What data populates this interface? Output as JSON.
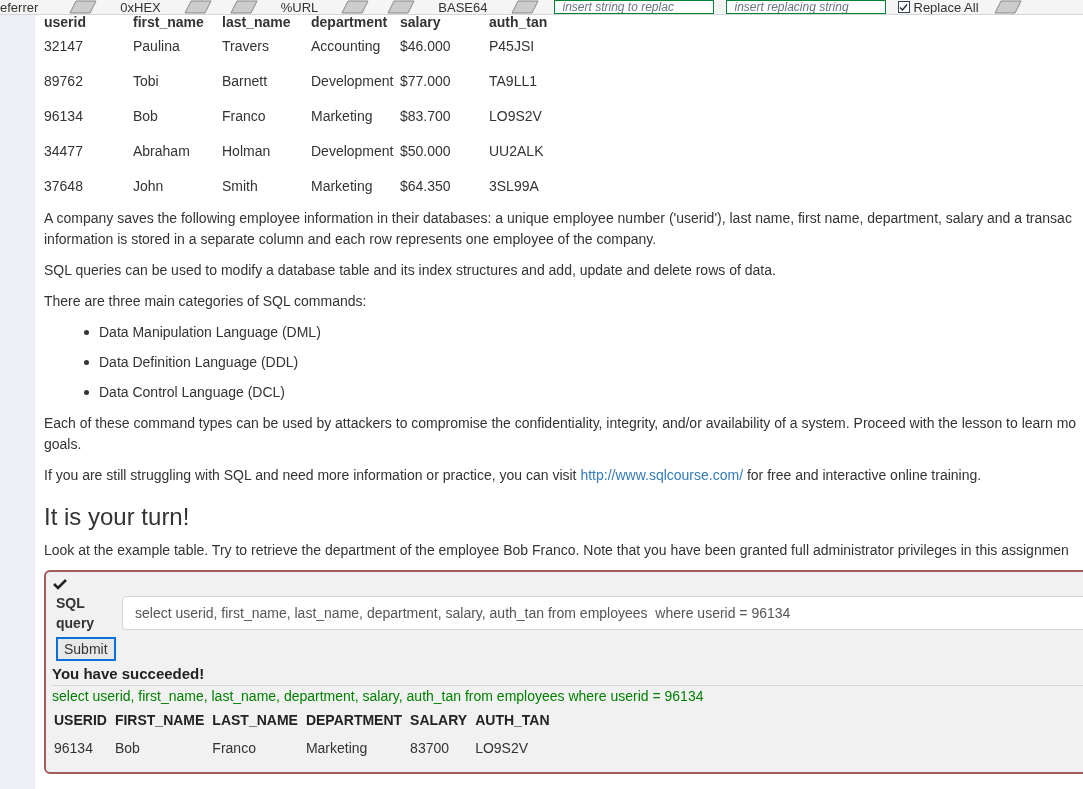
{
  "toolbar": {
    "items": [
      {
        "kind": "label",
        "text": "eferrer"
      },
      {
        "kind": "button",
        "text": "0xHEX"
      },
      {
        "kind": "button",
        "text": "%URL"
      },
      {
        "kind": "button",
        "text": "BASE64"
      },
      {
        "kind": "field",
        "placeholder": "insert string to replac"
      },
      {
        "kind": "field",
        "placeholder": "insert replacing string"
      },
      {
        "kind": "checkbox",
        "text": "Replace All",
        "checked": true
      }
    ]
  },
  "example_table": {
    "columns": [
      "userid",
      "first_name",
      "last_name",
      "department",
      "salary",
      "auth_tan"
    ],
    "rows": [
      [
        "32147",
        "Paulina",
        "Travers",
        "Accounting",
        "$46.000",
        "P45JSI"
      ],
      [
        "89762",
        "Tobi",
        "Barnett",
        "Development",
        "$77.000",
        "TA9LL1"
      ],
      [
        "96134",
        "Bob",
        "Franco",
        "Marketing",
        "$83.700",
        "LO9S2V"
      ],
      [
        "34477",
        "Abraham",
        "Holman",
        "Development",
        "$50.000",
        "UU2ALK"
      ],
      [
        "37648",
        "John",
        "Smith",
        "Marketing",
        "$64.350",
        "3SL99A"
      ]
    ]
  },
  "content": [
    {
      "kind": "paragraph",
      "lines": [
        "A company saves the following employee information in their databases: a unique employee number ('userid'), last name, first name, department, salary and a transac",
        "information is stored in a separate column and each row represents one employee of the company."
      ]
    },
    {
      "kind": "paragraph",
      "lines": [
        "SQL queries can be used to modify a database table and its index structures and add, update and delete rows of data."
      ]
    },
    {
      "kind": "paragraph",
      "lines": [
        "There are three main categories of SQL commands:"
      ]
    },
    {
      "kind": "list",
      "items": [
        "Data Manipulation Language (DML)",
        "Data Definition Language (DDL)",
        "Data Control Language (DCL)"
      ]
    },
    {
      "kind": "paragraph",
      "lines": [
        "Each of these command types can be used by attackers to compromise the confidentiality, integrity, and/or availability of a system. Proceed with the lesson to learn mo",
        "goals."
      ]
    },
    {
      "kind": "link_paragraph",
      "before": "If you are still struggling with SQL and need more information or practice, you can visit",
      "link": "http://www.sqlcourse.com/",
      "after": "for free and interactive online training."
    },
    {
      "kind": "heading",
      "text": "It is your turn!"
    },
    {
      "kind": "paragraph",
      "lines": [
        "Look at the example table. Try to retrieve the department of the employee Bob Franco. Note that you have been granted full administrator privileges in this assignmen"
      ]
    }
  ],
  "assignment": {
    "solved": true,
    "label": [
      "SQL",
      "query"
    ],
    "query": "select userid, first_name, last_name, department, salary, auth_tan from employees  where userid = 96134",
    "submit": "Submit",
    "feedback": "You have succeeded!",
    "output_query": "select userid, first_name, last_name, department, salary, auth_tan from employees where userid = 96134",
    "result": {
      "columns": [
        "USERID",
        "FIRST_NAME",
        "LAST_NAME",
        "DEPARTMENT",
        "SALARY",
        "AUTH_TAN"
      ],
      "rows": [
        [
          "96134",
          "Bob",
          "Franco",
          "Marketing",
          "83700",
          "LO9S2V"
        ]
      ]
    }
  }
}
